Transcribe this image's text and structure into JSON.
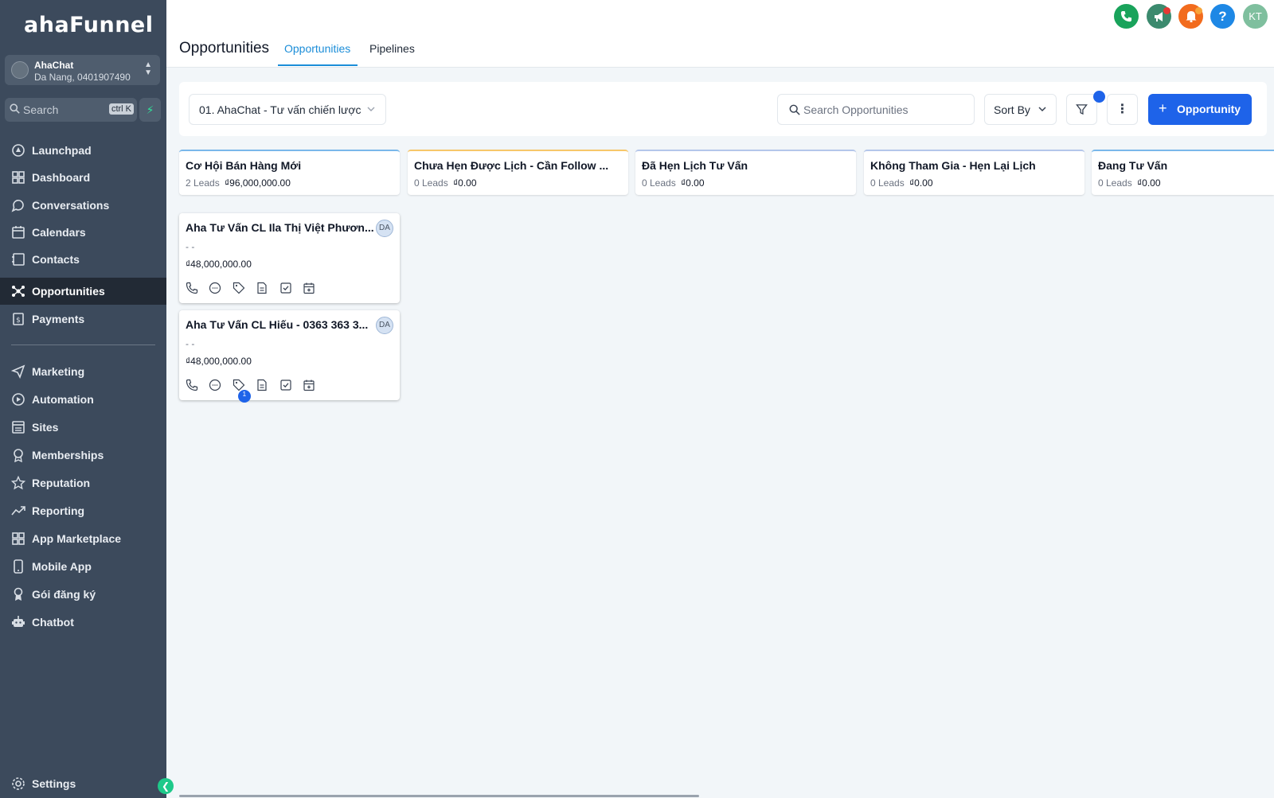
{
  "sidebar": {
    "logo": "ahaFunnel",
    "account": {
      "name": "AhaChat",
      "location": "Da Nang, 0401907490"
    },
    "search": {
      "label": "Search",
      "shortcut": "ctrl K"
    },
    "items": [
      {
        "label": "Launchpad",
        "icon": "rocket-icon"
      },
      {
        "label": "Dashboard",
        "icon": "grid-icon"
      },
      {
        "label": "Conversations",
        "icon": "chat-bubble-icon"
      },
      {
        "label": "Calendars",
        "icon": "calendar-icon"
      },
      {
        "label": "Contacts",
        "icon": "contacts-icon"
      },
      {
        "label": "Opportunities",
        "icon": "opportunities-icon",
        "active": true
      },
      {
        "label": "Payments",
        "icon": "payments-icon"
      },
      {
        "label": "Marketing",
        "icon": "send-icon"
      },
      {
        "label": "Automation",
        "icon": "automation-icon"
      },
      {
        "label": "Sites",
        "icon": "sites-icon"
      },
      {
        "label": "Memberships",
        "icon": "membership-icon"
      },
      {
        "label": "Reputation",
        "icon": "star-icon"
      },
      {
        "label": "Reporting",
        "icon": "trend-icon"
      },
      {
        "label": "App Marketplace",
        "icon": "apps-icon"
      },
      {
        "label": "Mobile App",
        "icon": "mobile-icon"
      },
      {
        "label": "Gói đăng ký",
        "icon": "award-icon"
      },
      {
        "label": "Chatbot",
        "icon": "robot-icon"
      }
    ],
    "settings": "Settings"
  },
  "header": {
    "title": "Opportunities",
    "tabs": [
      {
        "label": "Opportunities",
        "active": true
      },
      {
        "label": "Pipelines"
      }
    ],
    "actions": {
      "phone_color": "#19a35b",
      "announce_color": "#3b8a6e",
      "bell_color": "#f26b1d",
      "help_color": "#1e88e5",
      "avatar_initials": "KT",
      "avatar_color": "#7fbf9e"
    }
  },
  "toolbar": {
    "pipeline": "01. AhaChat - Tư vấn chiến lược",
    "search_placeholder": "Search Opportunities",
    "sort_label": "Sort By",
    "add_label": "Opportunity"
  },
  "stages": [
    {
      "name": "Cơ Hội Bán Hàng Mới",
      "leads": "2 Leads",
      "value": "₫96,000,000.00",
      "color": "#7ab8ea"
    },
    {
      "name": "Chưa Hẹn Được Lịch - Cần Follow ...",
      "leads": "0 Leads",
      "value": "₫0.00",
      "color": "#f7c76a"
    },
    {
      "name": "Đã Hẹn Lịch Tư Vấn",
      "leads": "0 Leads",
      "value": "₫0.00",
      "color": "#b4c6ea"
    },
    {
      "name": "Không Tham Gia - Hẹn Lại Lịch",
      "leads": "0 Leads",
      "value": "₫0.00",
      "color": "#b4c6ea"
    },
    {
      "name": "Đang Tư Vấn",
      "leads": "0 Leads",
      "value": "₫0.00",
      "color": "#7ab8ea"
    }
  ],
  "cards": [
    {
      "name": "Aha Tư Vấn CL Ila Thị Việt Phươn...",
      "avatar": "DA",
      "detail": "- -",
      "value": "₫48,000,000.00",
      "tag_badge": ""
    },
    {
      "name": "Aha Tư Vấn CL Hiếu - 0363 363 3...",
      "avatar": "DA",
      "detail": "- -",
      "value": "₫48,000,000.00",
      "tag_badge": "1"
    }
  ]
}
